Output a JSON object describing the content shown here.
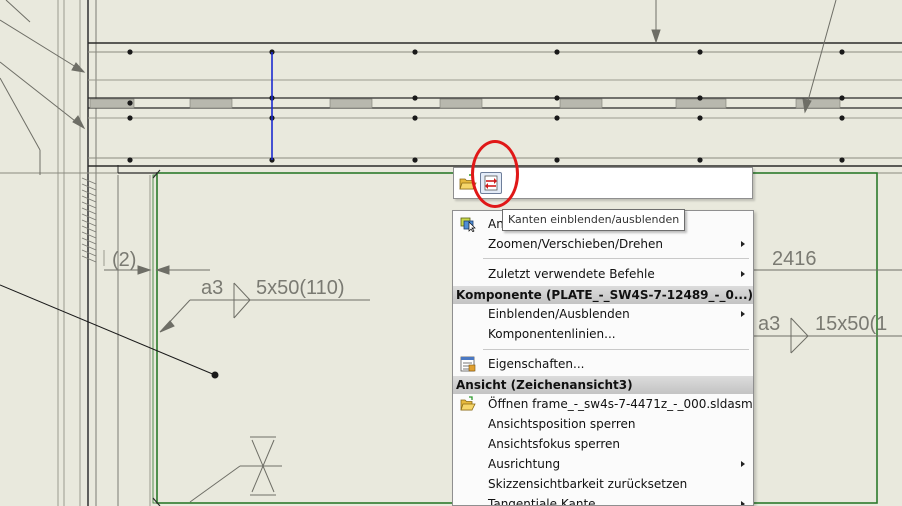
{
  "drawing": {
    "dim_2416": "2416",
    "weld_label_1": "a3",
    "weld_size_1": "5x50(110)",
    "weld_label_2": "a3",
    "weld_size_2": "15x50(1",
    "count_label": "(2)"
  },
  "toolbar": {
    "open_icon": "folder-open-icon",
    "toggle_icon": "show-hide-edges-icon"
  },
  "tooltip": {
    "text": "Kanten einblenden/ausblenden"
  },
  "context_menu": {
    "items_top": [
      {
        "label": "An",
        "icon": "select-cursor-icon",
        "submenu": false
      },
      {
        "label": "Zoomen/Verschieben/Drehen",
        "submenu": true
      },
      {
        "label": "Zuletzt verwendete Befehle",
        "submenu": true
      }
    ],
    "section_component": "Komponente (PLATE_-_SW4S-7-12489_-_0...)",
    "component_items": [
      {
        "label": "Einblenden/Ausblenden",
        "submenu": true
      },
      {
        "label": "Komponentenlinien...",
        "submenu": false
      },
      {
        "label": "Eigenschaften...",
        "icon": "properties-icon",
        "submenu": false
      }
    ],
    "section_view": "Ansicht (Zeichenansicht3)",
    "view_items": [
      {
        "label": "Öffnen frame_-_sw4s-7-4471z_-_000.sldasm",
        "icon": "folder-open-icon",
        "submenu": false
      },
      {
        "label": "Ansichtsposition sperren",
        "submenu": false
      },
      {
        "label": "Ansichtsfokus sperren",
        "submenu": false
      },
      {
        "label": "Ausrichtung",
        "submenu": true
      },
      {
        "label": "Skizzensichtbarkeit zurücksetzen",
        "submenu": false
      },
      {
        "label": "Tangentiale Kante",
        "submenu": true
      }
    ]
  },
  "colors": {
    "background": "#e9e9dd",
    "highlight_circle": "#e01818",
    "selected_line": "#1c2bd0",
    "component_border": "#2c7a2c"
  }
}
